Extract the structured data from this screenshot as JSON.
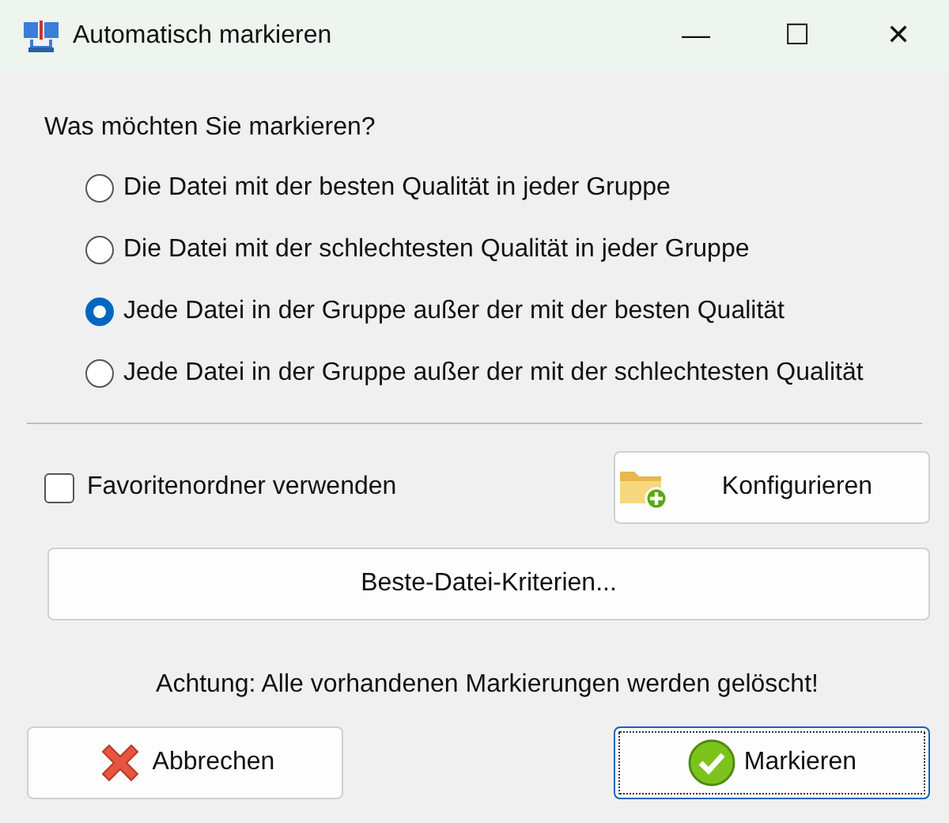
{
  "window": {
    "title": "Automatisch markieren",
    "controls": [
      "—",
      "☐",
      "✕"
    ]
  },
  "question": "Was möchten Sie markieren?",
  "options": [
    {
      "label": "Die Datei mit der besten Qualität in jeder Gruppe",
      "selected": false
    },
    {
      "label": "Die Datei mit der schlechtesten Qualität in jeder Gruppe",
      "selected": false
    },
    {
      "label": "Jede Datei in der Gruppe außer der mit der besten Qualität",
      "selected": true
    },
    {
      "label": "Jede Datei in der Gruppe außer der mit der schlechtesten Qualität",
      "selected": false
    }
  ],
  "favorites": {
    "label": "Favoritenordner verwenden",
    "checked": false
  },
  "configure_button": "Konfigurieren",
  "criteria_button": "Beste-Datei-Kriterien...",
  "warning": "Achtung: Alle vorhandenen Markierungen werden gelöscht!",
  "buttons": [
    {
      "label": "Abbrechen",
      "kind": "cancel",
      "focused": false
    },
    {
      "label": "Markieren",
      "kind": "ok",
      "focused": true
    }
  ]
}
